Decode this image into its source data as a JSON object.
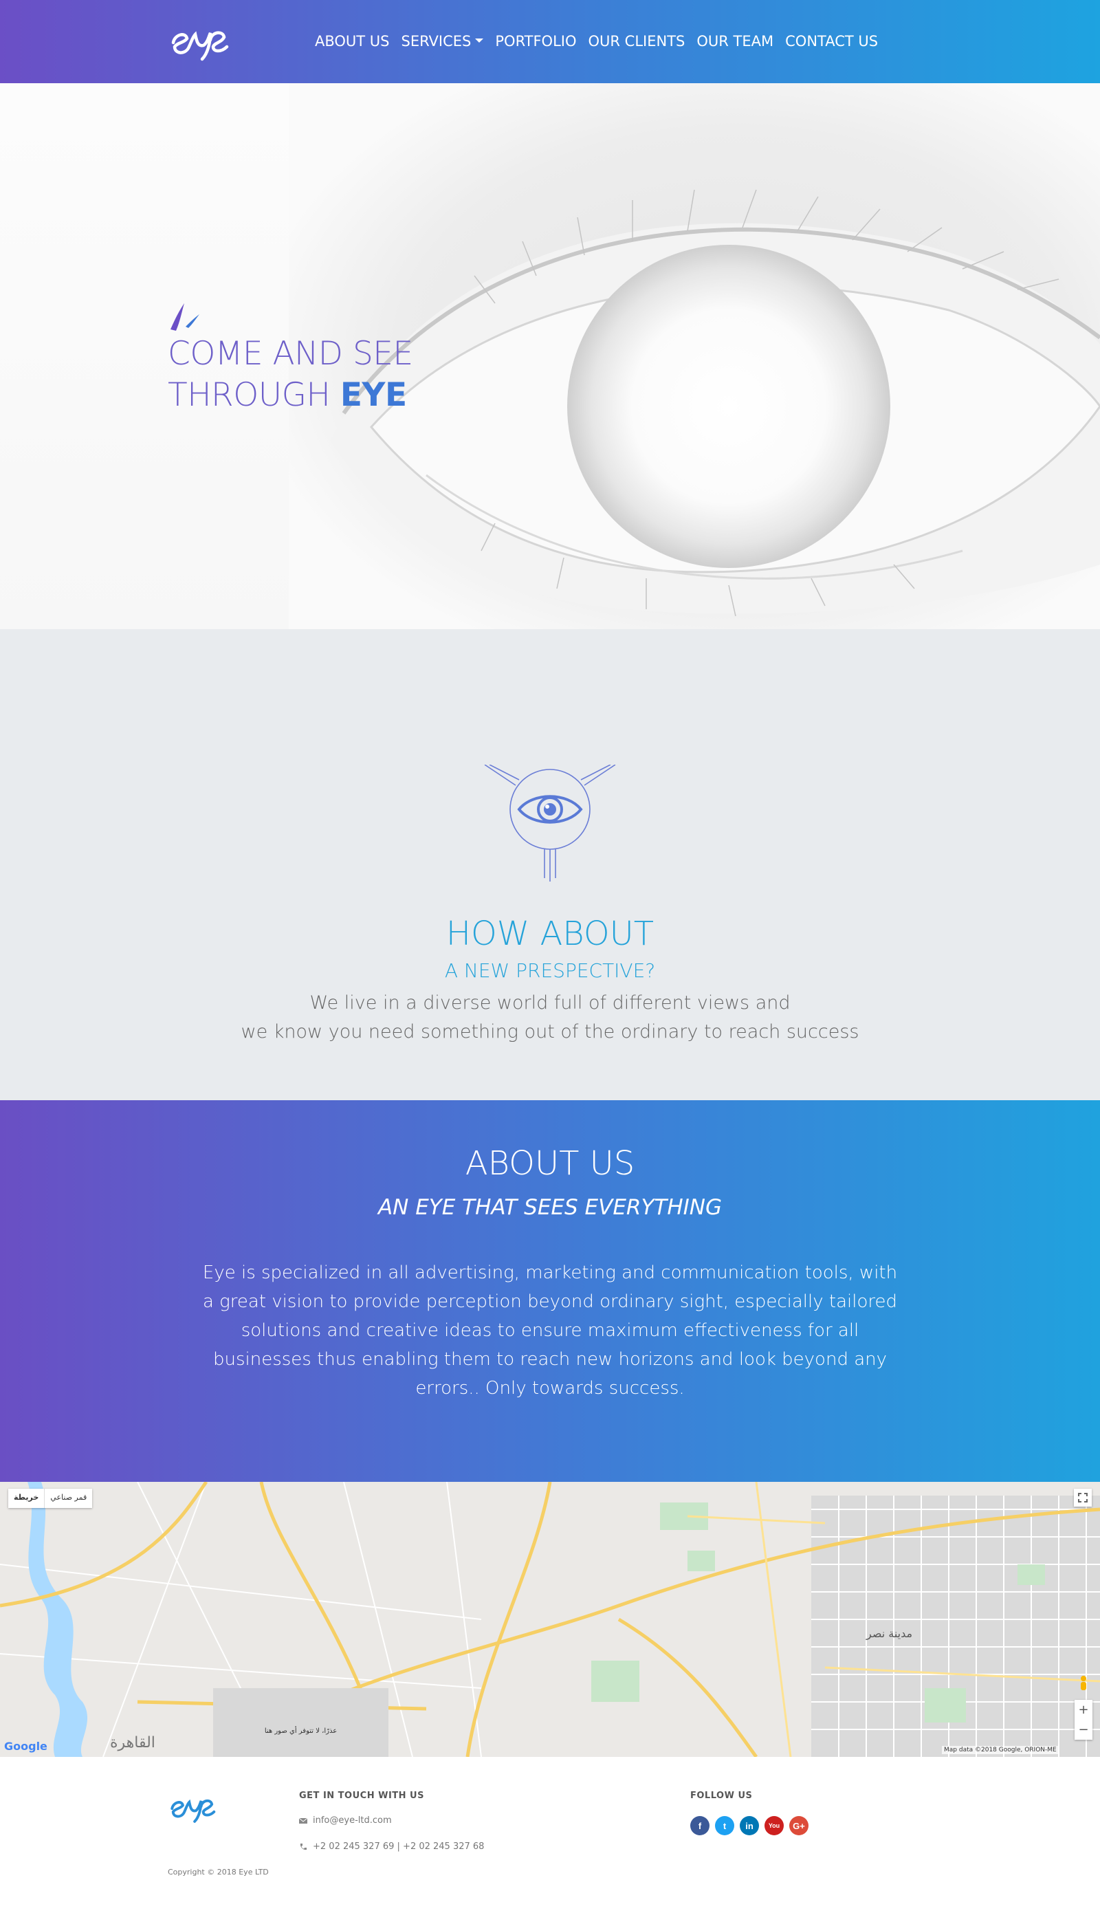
{
  "nav": {
    "items": [
      {
        "label": "ABOUT US"
      },
      {
        "label": "SERVICES"
      },
      {
        "label": "PORTFOLIO"
      },
      {
        "label": "OUR CLIENTS"
      },
      {
        "label": "OUR TEAM"
      },
      {
        "label": "CONTACT US"
      }
    ]
  },
  "hero": {
    "line1": "COME AND SEE",
    "line2_prefix": "THROUGH ",
    "line2_brand": "EYE"
  },
  "how": {
    "title": "HOW ABOUT",
    "subtitle": "A NEW PRESPECTIVE?",
    "line1": "We live in a diverse world full of different views and",
    "line2": "we know you need something out of the ordinary to reach success"
  },
  "about": {
    "title": "ABOUT US",
    "subtitle": "AN EYE THAT SEES EVERYTHING",
    "text": "Eye is specialized in all advertising, marketing and communication tools, with a great vision to provide perception beyond ordinary sight, especially tailored solutions and creative ideas to ensure maximum effectiveness for all businesses thus enabling them to reach new horizons and look beyond any errors.. Only towards success."
  },
  "map": {
    "toggle_map": "خريطة",
    "toggle_satellite": "قمر صناعي",
    "google": "Google",
    "attribution": "Map data ©2018 Google, ORION-ME",
    "box_text": "عذرًا، لا تتوفر أي صور هنا",
    "zoom_in": "+",
    "zoom_out": "−",
    "city_label": "القاهرة",
    "district_label": "مدينة نصر"
  },
  "footer": {
    "contact_heading": "GET IN TOUCH WITH US",
    "email": "info@eye-ltd.com",
    "phones": "+2 02 245 327 69 | +2 02 245 327 68",
    "follow_heading": "FOLLOW US",
    "copyright": "Copyright © 2018 Eye LTD"
  },
  "colors": {
    "gradient_start": "#6b4fc6",
    "gradient_end": "#1ea3e0",
    "accent_blue": "#26a3d9",
    "hero_text": "#6d5fc9"
  },
  "social": [
    {
      "name": "facebook-icon",
      "glyph": "f",
      "color": "#3b5998"
    },
    {
      "name": "twitter-icon",
      "glyph": "t",
      "color": "#1da1f2"
    },
    {
      "name": "linkedin-icon",
      "glyph": "in",
      "color": "#0077b5"
    },
    {
      "name": "youtube-icon",
      "glyph": "You",
      "color": "#cd201f"
    },
    {
      "name": "google-plus-icon",
      "glyph": "G+",
      "color": "#dd4b39"
    }
  ]
}
